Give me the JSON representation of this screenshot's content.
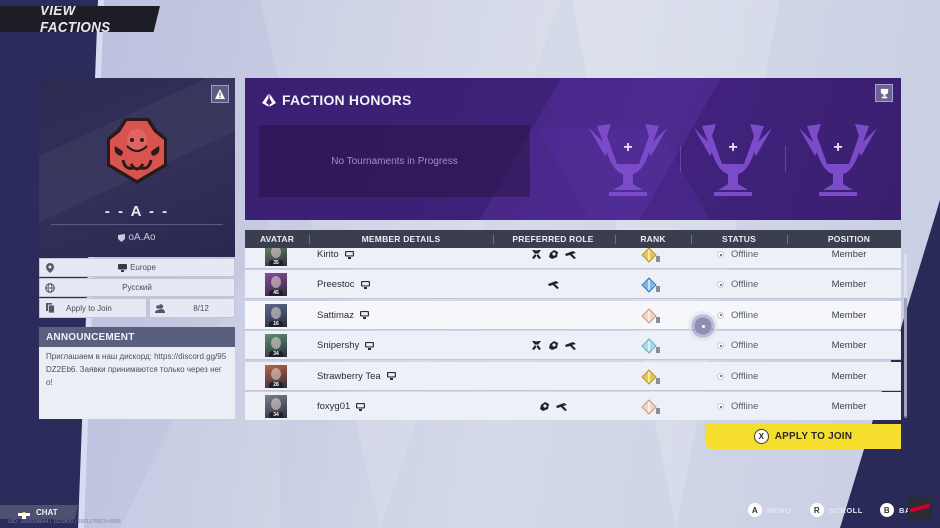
{
  "header": {
    "title": "VIEW FACTIONS"
  },
  "faction": {
    "name": "- - A - -",
    "tag": "oA.Ao",
    "region": "Europe",
    "language": "Русский",
    "join_policy": "Apply to Join",
    "member_count": "8/12",
    "logo_color": "#d9534f",
    "report_icon": "warning-icon"
  },
  "announcement": {
    "title": "ANNOUNCEMENT",
    "text": "Приглашаем в наш дискорд: https://discord.gg/95DZ2Eb6. Заявки принимаются только через него!"
  },
  "honors": {
    "title": "FACTION HONORS",
    "empty_text": "No Tournaments in Progress",
    "trophy_slots": 3,
    "slot_label": "+"
  },
  "table": {
    "columns": [
      "AVATAR",
      "MEMBER DETAILS",
      "PREFERRED ROLE",
      "RANK",
      "STATUS",
      "POSITION"
    ],
    "rows": [
      {
        "name": "Kirito",
        "level": "35",
        "platform": "pc-icon",
        "roles": [
          "vanguard",
          "duelist",
          "strategist"
        ],
        "rank": "gold",
        "status": "Offline",
        "position": "Member",
        "avatar_color": "#6f8f6a"
      },
      {
        "name": "Preestoc",
        "level": "45",
        "platform": "pc-icon",
        "roles": [
          "strategist"
        ],
        "rank": "diamond",
        "status": "Offline",
        "position": "Member",
        "avatar_color": "#8a4b9c"
      },
      {
        "name": "Sattimaz",
        "level": "16",
        "platform": "pc-icon",
        "roles": [],
        "rank": "bronze",
        "status": "Offline",
        "position": "Member",
        "avatar_color": "#5d6a8e"
      },
      {
        "name": "Snipershy",
        "level": "34",
        "platform": "pc-icon",
        "roles": [
          "vanguard",
          "duelist",
          "strategist"
        ],
        "rank": "platinum",
        "status": "Offline",
        "position": "Member",
        "avatar_color": "#5e8f78"
      },
      {
        "name": "Strawberry Tea",
        "level": "28",
        "platform": "pc-icon",
        "roles": [],
        "rank": "gold",
        "status": "Offline",
        "position": "Member",
        "avatar_color": "#c0624e"
      },
      {
        "name": "foxyg01",
        "level": "34",
        "platform": "pc-icon",
        "roles": [
          "duelist",
          "strategist"
        ],
        "rank": "bronze",
        "status": "Offline",
        "position": "Member",
        "avatar_color": "#7d7f8e"
      }
    ]
  },
  "actions": {
    "apply_button_key": "X",
    "apply_button_label": "APPLY TO JOIN",
    "apply_color": "#f5df2c"
  },
  "footer": {
    "chat_label": "CHAT",
    "uid_text": "UID: 1000008644 | 1520830 | 2001170813×0900",
    "hints": [
      {
        "key": "A",
        "label": "MENU"
      },
      {
        "key": "R",
        "label": "SCROLL"
      },
      {
        "key": "B",
        "label": "BA"
      }
    ]
  }
}
